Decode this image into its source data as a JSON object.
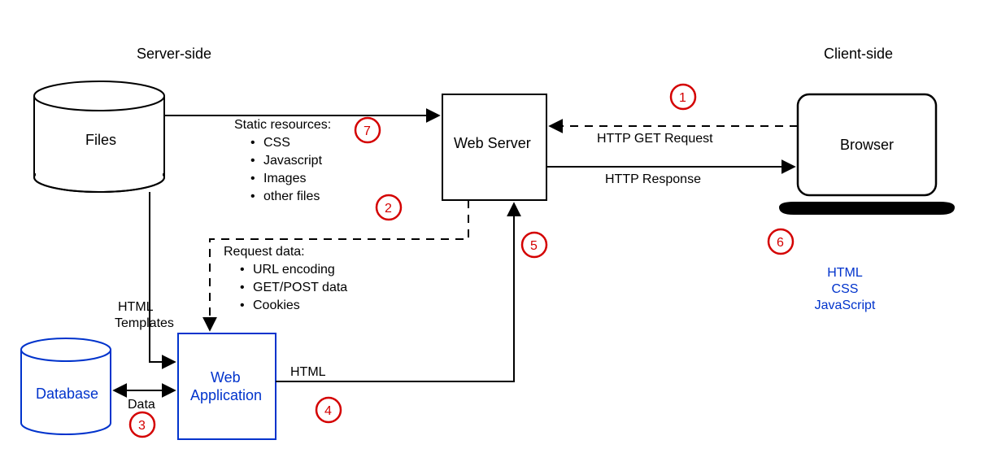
{
  "headers": {
    "server": "Server-side",
    "client": "Client-side"
  },
  "nodes": {
    "files": "Files",
    "web_server": "Web Server",
    "browser": "Browser",
    "database": "Database",
    "web_app_line1": "Web",
    "web_app_line2": "Application"
  },
  "static_resources": {
    "title": "Static resources:",
    "items": [
      "CSS",
      "Javascript",
      "Images",
      "other files"
    ]
  },
  "request_data": {
    "title": "Request data:",
    "items": [
      "URL encoding",
      "GET/POST data",
      "Cookies"
    ]
  },
  "edges": {
    "http_get": "HTTP GET Request",
    "http_response": "HTTP Response",
    "html_templates_line1": "HTML",
    "html_templates_line2": "Templates",
    "data": "Data",
    "html": "HTML"
  },
  "markers": {
    "1": "1",
    "2": "2",
    "3": "3",
    "4": "4",
    "5": "5",
    "6": "6",
    "7": "7"
  },
  "client_tech": [
    "HTML",
    "CSS",
    "JavaScript"
  ]
}
